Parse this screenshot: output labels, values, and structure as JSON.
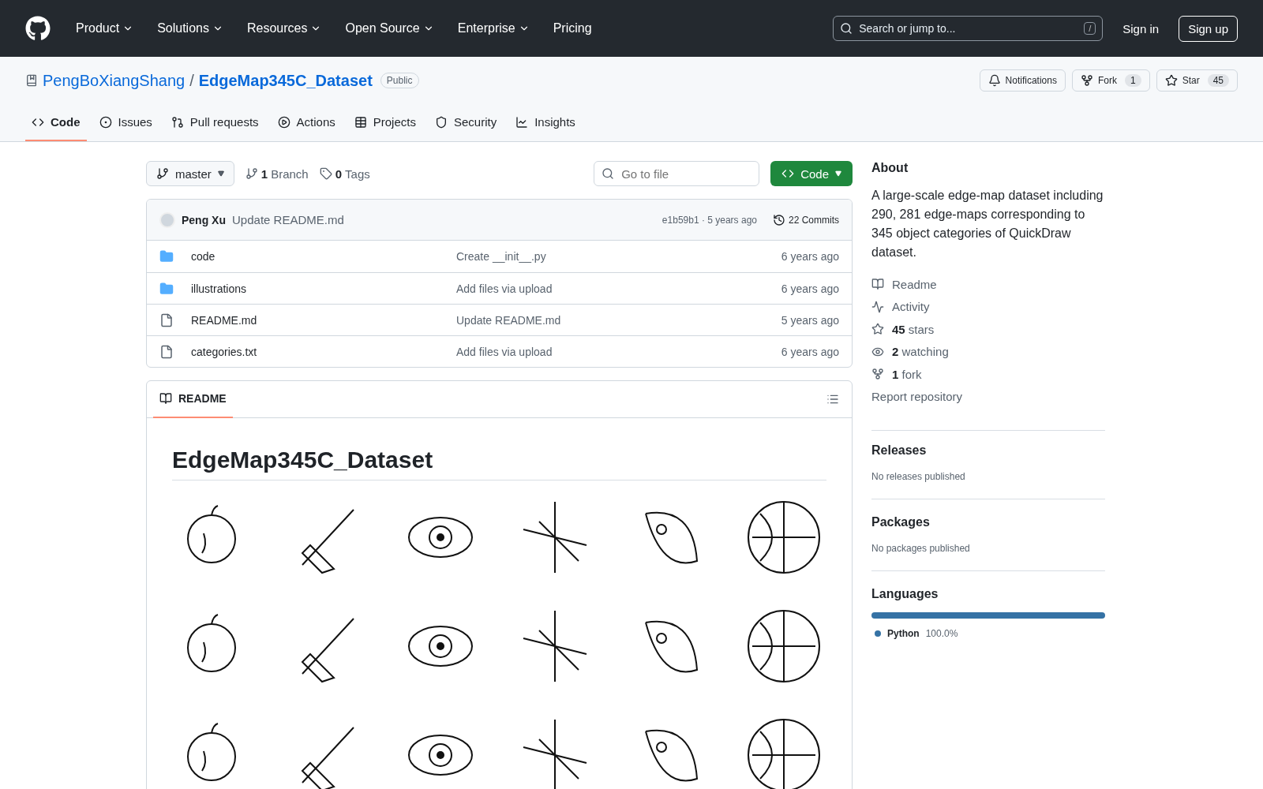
{
  "header": {
    "nav": [
      "Product",
      "Solutions",
      "Resources",
      "Open Source",
      "Enterprise"
    ],
    "nav_link": "Pricing",
    "search": {
      "placeholder": "Search or jump to...",
      "shortcut": "/"
    },
    "sign_in": "Sign in",
    "sign_up": "Sign up"
  },
  "repo": {
    "owner": "PengBoXiangShang",
    "separator": "/",
    "name": "EdgeMap345C_Dataset",
    "visibility": "Public",
    "actions": [
      {
        "label": "Notifications"
      },
      {
        "label": "Fork",
        "count": "1"
      },
      {
        "label": "Star",
        "count": "45"
      }
    ]
  },
  "tabs": [
    {
      "label": "Code",
      "selected": true
    },
    {
      "label": "Issues",
      "selected": false
    },
    {
      "label": "Pull requests",
      "selected": false
    },
    {
      "label": "Actions",
      "selected": false
    },
    {
      "label": "Projects",
      "selected": false
    },
    {
      "label": "Security",
      "selected": false
    },
    {
      "label": "Insights",
      "selected": false
    }
  ],
  "toolbar": {
    "branch": "master",
    "branches": {
      "count": "1",
      "label": "Branch"
    },
    "tags": {
      "count": "0",
      "label": "Tags"
    },
    "go_to_file": {
      "placeholder": "Go to file"
    },
    "code_button": "Code"
  },
  "commit": {
    "author": "Peng Xu",
    "message": "Update README.md",
    "hash": "e1b59b1",
    "separator": "·",
    "time": "5 years ago",
    "commits": "22 Commits"
  },
  "files": [
    {
      "kind": "folder",
      "name": "code",
      "message": "Create __init__.py",
      "time": "6 years ago"
    },
    {
      "kind": "folder",
      "name": "illustrations",
      "message": "Add files via upload",
      "time": "6 years ago"
    },
    {
      "kind": "file",
      "name": "README.md",
      "message": "Update README.md",
      "time": "5 years ago"
    },
    {
      "kind": "file",
      "name": "categories.txt",
      "message": "Add files via upload",
      "time": "6 years ago"
    }
  ],
  "readme": {
    "tab": "README",
    "title": "EdgeMap345C_Dataset"
  },
  "about": {
    "title": "About",
    "description": "A large-scale edge-map dataset including 290, 281 edge-maps corresponding to 345 object categories of QuickDraw dataset.",
    "links": [
      {
        "label": "Readme"
      },
      {
        "label": "Activity"
      },
      {
        "count": "45",
        "label": "stars"
      },
      {
        "count": "2",
        "label": "watching"
      },
      {
        "count": "1",
        "label": "fork"
      }
    ],
    "report": "Report repository"
  },
  "releases": {
    "title": "Releases",
    "note": "No releases published"
  },
  "packages": {
    "title": "Packages",
    "note": "No packages published"
  },
  "languages": {
    "title": "Languages",
    "items": [
      {
        "name": "Python",
        "percent": "100.0%",
        "color": "#3572a5",
        "level": 1
      }
    ]
  }
}
